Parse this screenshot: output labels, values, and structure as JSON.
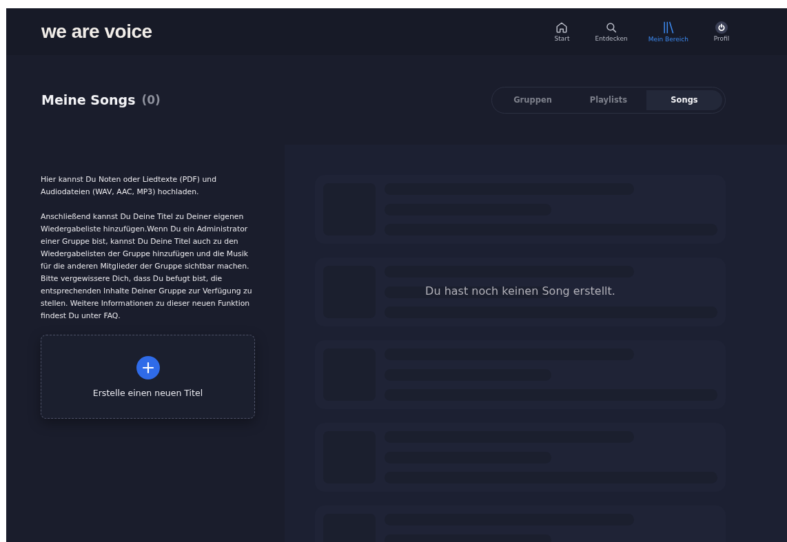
{
  "header": {
    "logo": "we are voice",
    "nav": [
      {
        "label": "Start",
        "selected": false
      },
      {
        "label": "Entdecken",
        "selected": false
      },
      {
        "label": "Mein Bereich",
        "selected": true
      },
      {
        "label": "Profil",
        "selected": false
      }
    ]
  },
  "page": {
    "title": "Meine Songs",
    "count": "(0)"
  },
  "tabs": [
    {
      "label": "Gruppen",
      "selected": false
    },
    {
      "label": "Playlists",
      "selected": false
    },
    {
      "label": "Songs",
      "selected": true
    }
  ],
  "intro": [
    "Hier kannst Du Noten oder Liedtexte (PDF) und Audiodateien (WAV, AAC, MP3) hochladen.",
    "Anschließend kannst Du Deine Titel zu Deiner eigenen Wiedergabeliste hinzufügen.Wenn Du ein Administrator einer Gruppe bist, kannst Du Deine Titel auch zu den Wiedergabelisten der Gruppe hinzufügen und die Musik für die anderen Mitglieder der Gruppe sichtbar machen. Bitte vergewissere Dich, dass Du befugt bist, die entsprechenden Inhalte Deiner Gruppe zur Verfügung zu stellen. Weitere Informationen zu dieser neuen Funktion findest Du unter FAQ."
  ],
  "create": {
    "label": "Erstelle einen neuen Titel"
  },
  "empty_message": "Du hast noch keinen Song erstellt."
}
